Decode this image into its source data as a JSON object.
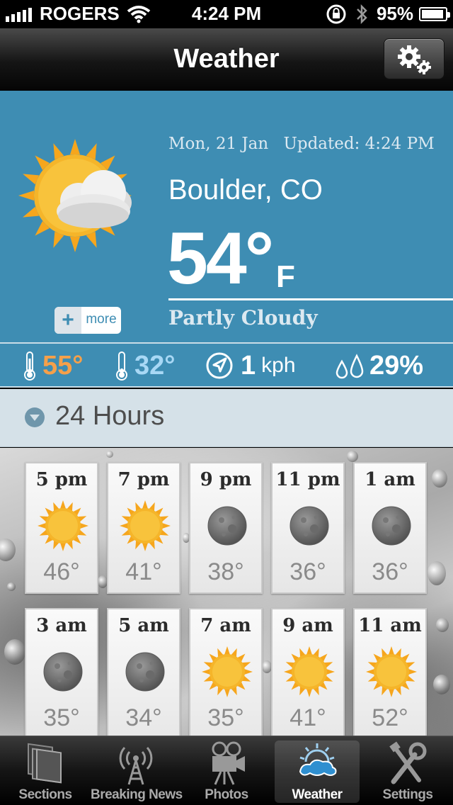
{
  "status_bar": {
    "carrier": "ROGERS",
    "time": "4:24 PM",
    "battery": "95%"
  },
  "navbar": {
    "title": "Weather"
  },
  "current": {
    "date": "Mon, 21 Jan",
    "updated": "Updated: 4:24 PM",
    "location": "Boulder, CO",
    "temperature": "54°",
    "unit": "F",
    "condition": "Partly Cloudy",
    "more_label": "more",
    "more_plus": "+"
  },
  "stats": {
    "high": "55°",
    "low": "32°",
    "wind_value": "1",
    "wind_unit": "kph",
    "humidity": "29%"
  },
  "section": {
    "label": "24 Hours"
  },
  "hourly": [
    {
      "hour": "5 pm",
      "temp": "46°",
      "icon": "sun-icon"
    },
    {
      "hour": "7 pm",
      "temp": "41°",
      "icon": "sun-icon"
    },
    {
      "hour": "9 pm",
      "temp": "38°",
      "icon": "moon-icon"
    },
    {
      "hour": "11 pm",
      "temp": "36°",
      "icon": "moon-icon"
    },
    {
      "hour": "1 am",
      "temp": "36°",
      "icon": "moon-icon"
    },
    {
      "hour": "3 am",
      "temp": "35°",
      "icon": "moon-icon"
    },
    {
      "hour": "5 am",
      "temp": "34°",
      "icon": "moon-icon"
    },
    {
      "hour": "7 am",
      "temp": "35°",
      "icon": "sun-icon"
    },
    {
      "hour": "9 am",
      "temp": "41°",
      "icon": "sun-icon"
    },
    {
      "hour": "11 am",
      "temp": "52°",
      "icon": "sun-icon"
    }
  ],
  "tabs": [
    {
      "label": "Sections",
      "icon": "sections-icon"
    },
    {
      "label": "Breaking News",
      "icon": "broadcast-tower-icon"
    },
    {
      "label": "Photos",
      "icon": "movie-camera-icon"
    },
    {
      "label": "Weather",
      "icon": "weather-icon"
    },
    {
      "label": "Settings",
      "icon": "tools-icon"
    }
  ],
  "colors": {
    "primary_blue": "#3e8db3",
    "high_temp": "#f5a04a",
    "low_temp": "#a8d8f5"
  }
}
